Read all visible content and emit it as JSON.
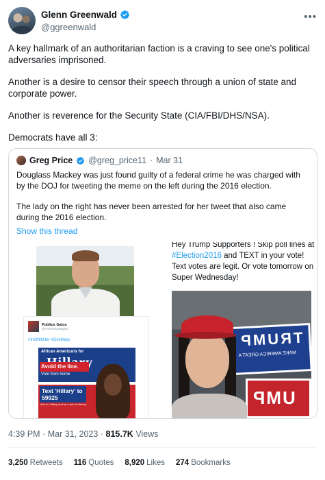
{
  "author": {
    "name": "Glenn Greenwald",
    "handle": "@ggreenwald"
  },
  "tweet": {
    "paragraphs": [
      "A key hallmark of an authoritarian faction is a craving to see one's political adversaries imprisoned.",
      "Another is a desire to censor their speech through a union of state and corporate power.",
      "Another is reverence for the Security State (CIA/FBI/DHS/NSA).",
      "Democrats have all 3:"
    ]
  },
  "quote": {
    "name": "Greg Price",
    "handle": "@greg_price11",
    "separator": "·",
    "date": "Mar 31",
    "paragraphs": [
      "Douglass Mackey was just found guilty of a federal crime he was charged with by the DOJ for tweeting the meme on the left during the 2016 election.",
      "The lady on the right has never been arrested for her tweet that also came during the 2016 election."
    ],
    "show_thread": "Show this thread",
    "left_media": {
      "meme_user_name": "Publius Gaius",
      "meme_user_handle": "@TheRickyVaughn",
      "meme_hashtags": "#ImWithHer #GoHillary",
      "poster_top": "African Americans for",
      "poster_title": "Hillary",
      "poster_avoid": "Avoid the line.",
      "poster_from": "Vote from home",
      "poster_text": "Text 'Hillary' to 59925",
      "poster_small": "Vote for Hillary and be a part of history."
    },
    "right_media": {
      "text_pre": "Hey  Trump Supporters ! Skip poll lines at ",
      "hashtag": "#Election2016",
      "text_post": " and TEXT in your vote! Text votes are legit. Or vote tomorrow on Super Wednesday!",
      "sign_top": "TRUMP",
      "sign_top_sub": "MAKE AMERICA GREAT A",
      "sign_bottom": "UMP"
    }
  },
  "meta": {
    "time": "4:39 PM",
    "separator": "·",
    "date": "Mar 31, 2023",
    "views_count": "815.7K",
    "views_label": "Views"
  },
  "stats": {
    "retweets_count": "3,250",
    "retweets_label": "Retweets",
    "quotes_count": "116",
    "quotes_label": "Quotes",
    "likes_count": "8,920",
    "likes_label": "Likes",
    "bookmarks_count": "274",
    "bookmarks_label": "Bookmarks"
  },
  "colors": {
    "link": "#1d9bf0",
    "muted": "#536471",
    "text": "#0f1419",
    "border": "#cfd9de"
  }
}
